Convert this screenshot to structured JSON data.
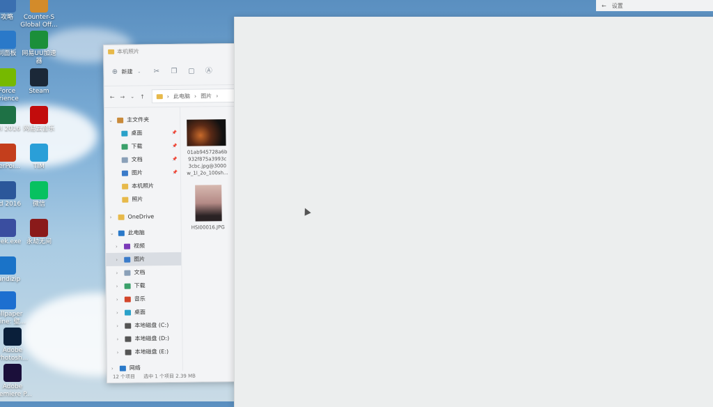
{
  "desktop": {
    "icons": [
      {
        "label": "攻略",
        "icon": "app-icon",
        "color": "#3a6fb0"
      },
      {
        "label": "Counter-S\nGlobal Off...",
        "icon": "csgo-icon",
        "color": "#d38b2a"
      },
      {
        "label": "制面板",
        "icon": "control-panel-icon",
        "color": "#2a79c9"
      },
      {
        "label": "网易UU加速\n器",
        "icon": "uu-icon",
        "color": "#1b8f3a"
      },
      {
        "label": "Force\nerience",
        "icon": "geforce-icon",
        "color": "#76b900"
      },
      {
        "label": "Steam",
        "icon": "steam-icon",
        "color": "#1b2838"
      },
      {
        "label": "cel 2016",
        "icon": "excel-icon",
        "color": "#1e7145"
      },
      {
        "label": "网易云音乐",
        "icon": "netease-music-icon",
        "color": "#c20c0c"
      },
      {
        "label": "werPoi...",
        "icon": "powerpoint-icon",
        "color": "#c43e1c"
      },
      {
        "label": "TIM",
        "icon": "tim-icon",
        "color": "#2a9fd8"
      },
      {
        "label": "ord 2016",
        "icon": "word-icon",
        "color": "#2b579a"
      },
      {
        "label": "微信",
        "icon": "wechat-icon",
        "color": "#07c160"
      },
      {
        "label": "geek.exe",
        "icon": "geek-icon",
        "color": "#3a4ea0"
      },
      {
        "label": "永劫无间",
        "icon": "game-icon",
        "color": "#8a1a1a"
      },
      {
        "label": "Bandizip",
        "icon": "bandizip-icon",
        "color": "#1a73c8"
      },
      {
        "label": "Wallpaper\nEngine: 壁...",
        "icon": "wallpaper-engine-icon",
        "color": "#1d6fd0"
      },
      {
        "label": "Adobe\nPhotosh...",
        "icon": "photoshop-icon",
        "color": "#0a1f3a"
      },
      {
        "label": "Adobe\nPremiere P...",
        "icon": "premiere-icon",
        "color": "#1b0f3a"
      }
    ]
  },
  "explorer": {
    "title": "本机照片",
    "toolbar": {
      "new_label": "新建"
    },
    "address": {
      "crumb1": "此电脑",
      "crumb2": "图片"
    },
    "nav": {
      "home": "主文件夹",
      "quick": [
        {
          "label": "桌面",
          "color": "#2aa1c9",
          "pinned": true
        },
        {
          "label": "下载",
          "color": "#3aa06a",
          "pinned": true
        },
        {
          "label": "文档",
          "color": "#8aa0b8",
          "pinned": true
        },
        {
          "label": "图片",
          "color": "#3a7bc9",
          "pinned": true
        },
        {
          "label": "本机照片",
          "color": "#e7b94a",
          "pinned": false
        },
        {
          "label": "照片",
          "color": "#e7b94a",
          "pinned": false
        }
      ],
      "onedrive": "OneDrive",
      "thispc": "此电脑",
      "pc_items": [
        {
          "label": "视频",
          "color": "#7a3ab8"
        },
        {
          "label": "图片",
          "color": "#3a7bc9"
        },
        {
          "label": "文档",
          "color": "#8aa0b8"
        },
        {
          "label": "下载",
          "color": "#3aa06a"
        },
        {
          "label": "音乐",
          "color": "#d2452a"
        },
        {
          "label": "桌面",
          "color": "#2aa1c9"
        },
        {
          "label": "本地磁盘 (C:)",
          "color": "#555"
        },
        {
          "label": "本地磁盘 (D:)",
          "color": "#555"
        },
        {
          "label": "本地磁盘 (E:)",
          "color": "#555"
        }
      ],
      "network": "网络"
    },
    "files": [
      {
        "name": "01ab945728a6b\n932f875a3993c\n3cbc.jpg@3000\nw_1l_2o_100sh..."
      },
      {
        "name": "HSI00016.JPG"
      }
    ],
    "status": {
      "count": "12 个项目",
      "selection": "选中 1 个项目  2.39 MB"
    }
  },
  "settings": {
    "title": "设置",
    "back": "←"
  }
}
